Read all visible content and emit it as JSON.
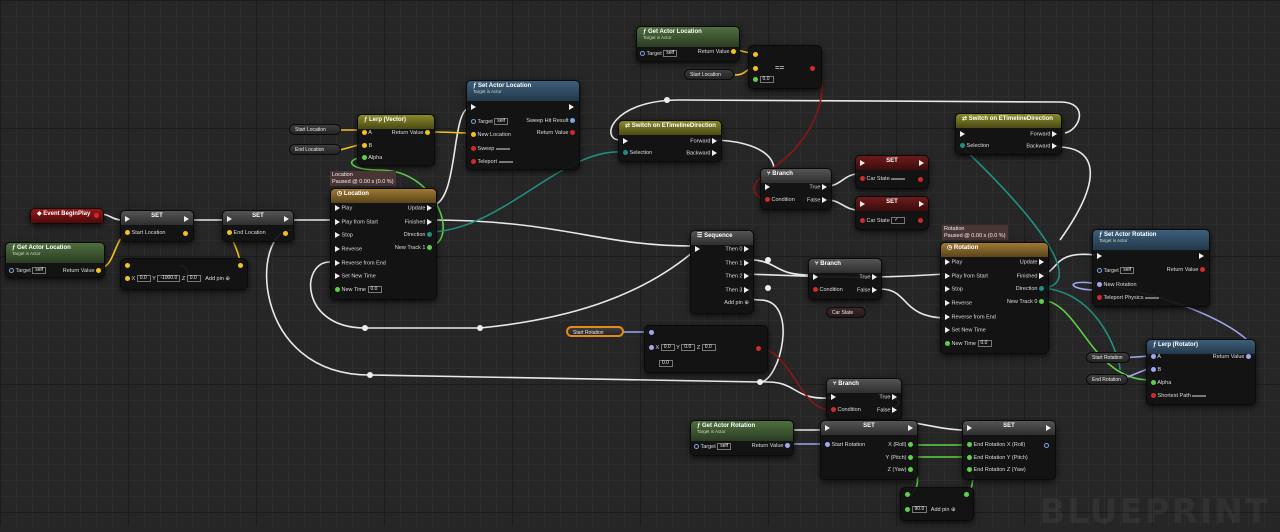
{
  "watermark": "BLUEPRINT",
  "nodes": {
    "event_begin_play": {
      "title": "Event BeginPlay"
    },
    "get_actor_location_1": {
      "title": "Get Actor Location",
      "subtitle": "Target is Actor",
      "target_label": "Target",
      "target_value": "self",
      "return_label": "Return Value"
    },
    "set_start_location": {
      "title": "SET",
      "pin": "Start Location"
    },
    "set_end_location": {
      "title": "SET",
      "pin": "End Location"
    },
    "make_vector": {
      "x_label": "X",
      "x_value": "0.0",
      "y_label": "Y",
      "y_value": "-1000.0",
      "z_label": "Z",
      "z_value": "0.0",
      "add_pin": "Add pin"
    },
    "var_start_location_1": {
      "label": "Start Location"
    },
    "var_end_location_1": {
      "label": "End Location"
    },
    "lerp_vector": {
      "title": "Lerp (Vector)",
      "a": "A",
      "b": "B",
      "alpha": "Alpha",
      "return": "Return Value"
    },
    "timeline_location": {
      "status_1": "Location",
      "status_2": "Paused @ 0.00 s (0.0 %)",
      "title": "Location",
      "play": "Play",
      "play_from_start": "Play from Start",
      "stop": "Stop",
      "reverse": "Reverse",
      "reverse_from_end": "Reverse from End",
      "set_new_time": "Set New Time",
      "new_time": "New Time",
      "new_time_value": "0.0",
      "update": "Update",
      "finished": "Finished",
      "direction": "Direction",
      "new_track": "New Track 1"
    },
    "set_actor_location": {
      "title": "Set Actor Location",
      "subtitle": "Target is Actor",
      "target": "Target",
      "target_value": "self",
      "new_location": "New Location",
      "sweep": "Sweep",
      "teleport": "Teleport",
      "sweep_hit": "Sweep Hit Result",
      "return": "Return Value"
    },
    "get_actor_location_2": {
      "title": "Get Actor Location",
      "subtitle": "Target is Actor",
      "target_label": "Target",
      "target_value": "self",
      "return_label": "Return Value"
    },
    "var_start_location_2": {
      "label": "Start Location"
    },
    "equal_node": {
      "symbol": "==",
      "value": "0.0"
    },
    "switch_direction_1": {
      "title": "Switch on ETimelineDirection",
      "selection": "Selection",
      "forward": "Forward",
      "backward": "Backward"
    },
    "switch_direction_2": {
      "title": "Switch on ETimelineDirection",
      "selection": "Selection",
      "forward": "Forward",
      "backward": "Backward"
    },
    "branch_1": {
      "title": "Branch",
      "condition": "Condition",
      "true": "True",
      "false": "False"
    },
    "set_car_state_1": {
      "title": "SET",
      "pin": "Car State"
    },
    "set_car_state_2": {
      "title": "SET",
      "pin": "Car State"
    },
    "sequence": {
      "title": "Sequence",
      "then0": "Then 0",
      "then1": "Then 1",
      "then2": "Then 2",
      "then3": "Then 3",
      "add_pin": "Add pin"
    },
    "branch_2": {
      "title": "Branch",
      "condition": "Condition",
      "true": "True",
      "false": "False"
    },
    "var_car_state": {
      "label": "Car State"
    },
    "timeline_rotation": {
      "status_1": "Rotation",
      "status_2": "Paused @ 0.00 s (0.0 %)",
      "title": "Rotation",
      "play": "Play",
      "play_from_start": "Play from Start",
      "stop": "Stop",
      "reverse": "Reverse",
      "reverse_from_end": "Reverse from End",
      "set_new_time": "Set New Time",
      "new_time": "New Time",
      "new_time_value": "0.0",
      "update": "Update",
      "finished": "Finished",
      "direction": "Direction",
      "new_track": "New Track 0"
    },
    "set_actor_rotation": {
      "title": "Set Actor Rotation",
      "subtitle": "Target is Actor",
      "target": "Target",
      "target_value": "self",
      "new_rotation": "New Rotation",
      "teleport_physics": "Teleport Physics",
      "return": "Return Value"
    },
    "var_start_rotation_1": {
      "label": "Start Rotation"
    },
    "make_rotator": {
      "x_value": "0.0",
      "y_value": "0.0",
      "z_value": "0.0",
      "extra_value": "0.0"
    },
    "lerp_rotator": {
      "title": "Lerp (Rotator)",
      "a": "A",
      "b": "B",
      "alpha": "Alpha",
      "shortest_path": "Shortest Path",
      "return": "Return Value"
    },
    "var_start_rotation_2": {
      "label": "Start Rotation"
    },
    "var_end_rotation": {
      "label": "End Rotation"
    },
    "branch_3": {
      "title": "Branch",
      "condition": "Condition",
      "true": "True",
      "false": "False"
    },
    "get_actor_rotation": {
      "title": "Get Actor Rotation",
      "subtitle": "Target is Actor",
      "target": "Target",
      "target_value": "self",
      "return": "Return Value"
    },
    "set_start_rotation": {
      "title": "SET",
      "pin": "Start Rotation",
      "x": "X (Roll)",
      "y": "Y (Pitch)",
      "z": "Z (Yaw)"
    },
    "set_end_rotation": {
      "title": "SET",
      "x": "End Rotation X (Roll)",
      "y": "End Rotation Y (Pitch)",
      "z": "End Rotation Z (Yaw)"
    },
    "add_node": {
      "value": "90.0",
      "add_pin": "Add pin"
    }
  }
}
